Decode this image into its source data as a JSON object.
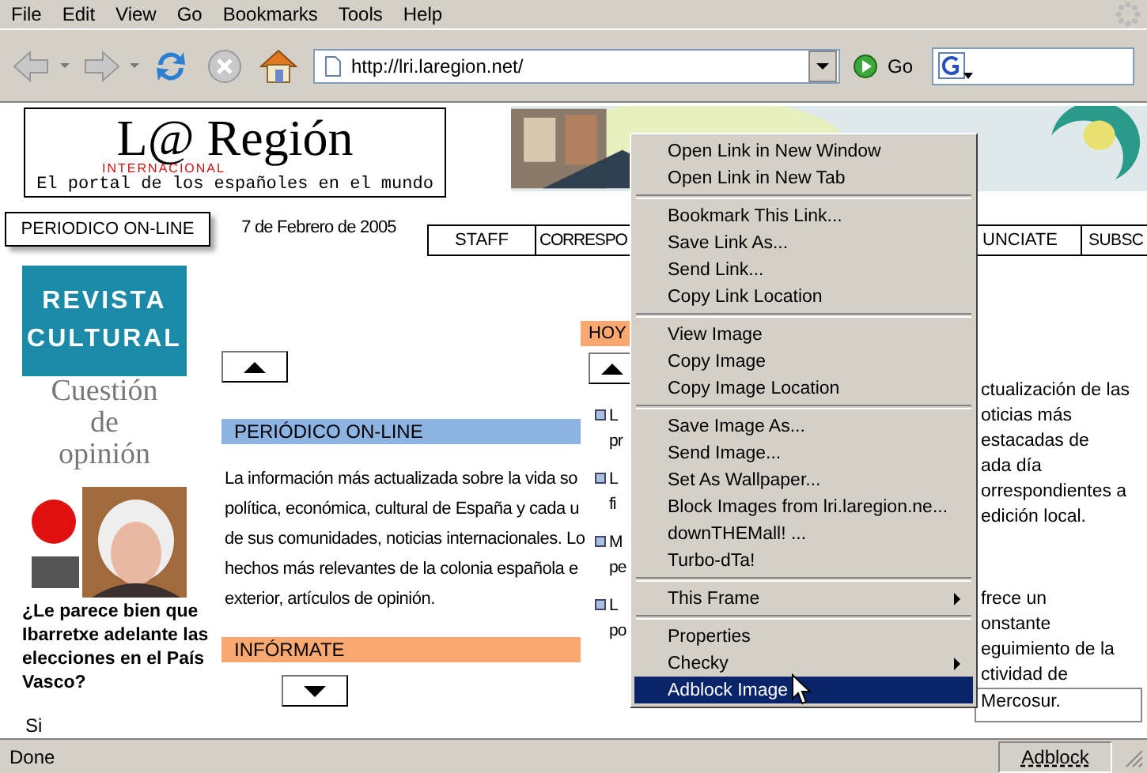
{
  "menubar": [
    "File",
    "Edit",
    "View",
    "Go",
    "Bookmarks",
    "Tools",
    "Help"
  ],
  "toolbar": {
    "buttons": [
      {
        "kind": "back",
        "disabled": true,
        "dropdown": true
      },
      {
        "kind": "forward",
        "disabled": true,
        "dropdown": true
      },
      {
        "kind": "reload",
        "disabled": false,
        "dropdown": false
      },
      {
        "kind": "stop",
        "disabled": true,
        "dropdown": false
      },
      {
        "kind": "home",
        "disabled": false,
        "dropdown": false
      }
    ],
    "url": "http://lri.laregion.net/",
    "go": "Go"
  },
  "page": {
    "logo": {
      "name": "L@ Región",
      "sub": "INTERNACIONAL",
      "tagline": "El portal de los españoles en el mundo"
    },
    "banner": {
      "kind": "picture"
    },
    "section_label": "PERIODICO ON-LINE",
    "date": "7 de Febrero de 2005",
    "nav": [
      "STAFF",
      "CORRESPO",
      "UNCIATE",
      "SUBSC"
    ],
    "revista": "REVISTA CULTURAL",
    "cuestion": [
      "Cuestión",
      "de",
      "opinión"
    ],
    "foro": {
      "kind": "picture"
    },
    "poll": {
      "question": "¿Le parece bien que Ibarretxe adelante las elecciones en el País Vasco?",
      "options": [
        "Si"
      ]
    },
    "main": {
      "scroll_up": {
        "kind": "up"
      },
      "heading": "PERIÓDICO ON-LINE",
      "lines": [
        "La información más actualizada sobre la vida so",
        "política, económica, cultural de España y cada u",
        "de sus comunidades, noticias internacionales. Lo",
        "hechos más relevantes de la colonia española e",
        "exterior, artículos de opinión."
      ],
      "heading2": "INFÓRMATE",
      "scroll_down": {
        "kind": "down"
      }
    },
    "today": {
      "heading": "HOY",
      "scroll_up": {
        "kind": "up"
      },
      "items": [
        [
          "L",
          "pr"
        ],
        [
          "L",
          "fi"
        ],
        [
          "M",
          "pe"
        ],
        [
          "L",
          "po"
        ]
      ]
    },
    "right": {
      "paragraphs": [
        [
          "ctualización de las",
          "oticias más",
          "estacadas de",
          "ada día",
          "orrespondientes a",
          "edición local."
        ],
        [
          "frece un",
          "onstante",
          "eguimiento de la",
          "ctividad de"
        ]
      ],
      "field": "Mercosur."
    }
  },
  "context_menu": {
    "groups": [
      [
        {
          "label": "Open Link in New Window",
          "submenu": false,
          "selected": false
        },
        {
          "label": "Open Link in New Tab",
          "submenu": false,
          "selected": false
        }
      ],
      [
        {
          "label": "Bookmark This Link...",
          "submenu": false,
          "selected": false
        },
        {
          "label": "Save Link As...",
          "submenu": false,
          "selected": false
        },
        {
          "label": "Send Link...",
          "submenu": false,
          "selected": false
        },
        {
          "label": "Copy Link Location",
          "submenu": false,
          "selected": false
        }
      ],
      [
        {
          "label": "View Image",
          "submenu": false,
          "selected": false
        },
        {
          "label": "Copy Image",
          "submenu": false,
          "selected": false
        },
        {
          "label": "Copy Image Location",
          "submenu": false,
          "selected": false
        }
      ],
      [
        {
          "label": "Save Image As...",
          "submenu": false,
          "selected": false
        },
        {
          "label": "Send Image...",
          "submenu": false,
          "selected": false
        },
        {
          "label": "Set As Wallpaper...",
          "submenu": false,
          "selected": false
        },
        {
          "label": "Block Images from lri.laregion.ne...",
          "submenu": false,
          "selected": false
        },
        {
          "label": "downTHEMall! ...",
          "submenu": false,
          "selected": false
        },
        {
          "label": "Turbo-dTa!",
          "submenu": false,
          "selected": false
        }
      ],
      [
        {
          "label": "This Frame",
          "submenu": true,
          "selected": false
        }
      ],
      [
        {
          "label": "Properties",
          "submenu": false,
          "selected": false
        },
        {
          "label": "Checky",
          "submenu": true,
          "selected": false
        },
        {
          "label": "Adblock Image",
          "submenu": false,
          "selected": true
        }
      ]
    ]
  },
  "status": {
    "text": "Done",
    "panel": "Adblock"
  }
}
